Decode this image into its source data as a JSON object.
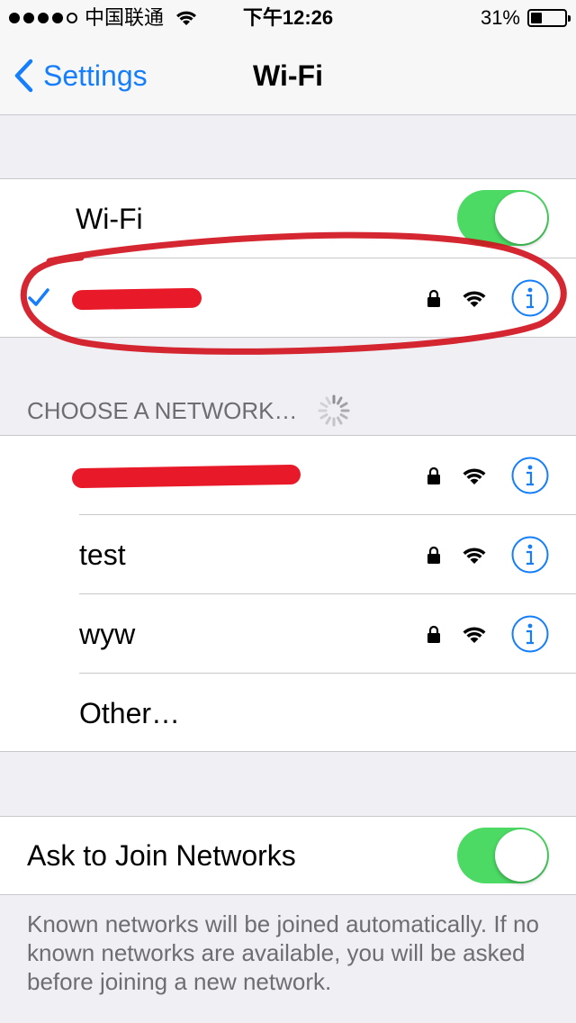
{
  "status_bar": {
    "carrier": "中国联通",
    "time": "下午12:26",
    "battery_percent": "31%",
    "signal_bars_filled": 4,
    "signal_bars_total": 5
  },
  "nav": {
    "back_label": "Settings",
    "title": "Wi-Fi"
  },
  "wifi_toggle": {
    "label": "Wi-Fi",
    "on": true
  },
  "connected_network": {
    "name_redacted": true,
    "checkmark": "✓",
    "secured": true
  },
  "choose_header": "CHOOSE A NETWORK…",
  "networks": [
    {
      "name": "",
      "redacted": true,
      "secured": true
    },
    {
      "name": "test",
      "redacted": false,
      "secured": true
    },
    {
      "name": "wyw",
      "redacted": false,
      "secured": true
    }
  ],
  "other_label": "Other…",
  "ask_to_join": {
    "label": "Ask to Join Networks",
    "on": true
  },
  "footer": "Known networks will be joined automatically. If no known networks are available, you will be asked before joining a new network.",
  "colors": {
    "accent": "#157efb",
    "toggle_on": "#4cd964",
    "background": "#efeff4",
    "annotation_red": "#e60012"
  },
  "icons": {
    "back": "chevron-left-icon",
    "lock": "lock-icon",
    "wifi": "wifi-icon",
    "info": "info-icon",
    "check": "checkmark-icon",
    "spinner": "spinner-icon"
  }
}
